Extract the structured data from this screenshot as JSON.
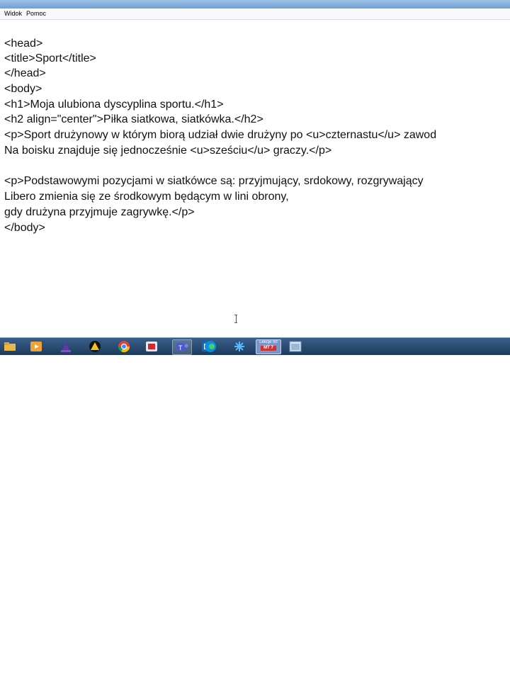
{
  "menu": {
    "items": [
      "Widok",
      "Pomoc"
    ]
  },
  "editor": {
    "lines": [
      "<head>",
      "<title>Sport</title>",
      "</head>",
      "<body>",
      "<h1>Moja ulubiona dyscyplina sportu.</h1>",
      "<h2 align=\"center\">Piłka siatkowa, siatkówka.</h2>",
      "<p>Sport drużynowy w którym biorą udział dwie drużyny po <u>czternastu</u> zawod",
      "Na boisku znajduje się jednocześnie <u>sześciu</u> graczy.</p>",
      "",
      "<p>Podstawowymi pozycjami w siatkówce są: przyjmujący, srdokowy, rozgrywający",
      "Libero zmienia się ze środkowym będącym w lini obrony,",
      "gdy drużyna przyjmuje zagrywkę.</p>",
      "</body>"
    ]
  },
  "taskbar": {
    "items": [
      {
        "icon": "file-explorer-icon"
      },
      {
        "icon": "media-player-icon"
      },
      {
        "icon": "wizard-icon"
      },
      {
        "icon": "warning-triangle-icon"
      },
      {
        "icon": "chrome-icon"
      },
      {
        "icon": "media-app-icon"
      },
      {
        "icon": "teams-icon"
      },
      {
        "icon": "outlook-icon"
      },
      {
        "icon": "edge-icon"
      },
      {
        "icon": "snowflake-icon"
      }
    ],
    "badge": {
      "top": "Lekcje Inf",
      "num": "MT 7"
    }
  },
  "colors": {
    "taskbar": "#1d3a5c",
    "titlebar": "#6f9fd0"
  }
}
